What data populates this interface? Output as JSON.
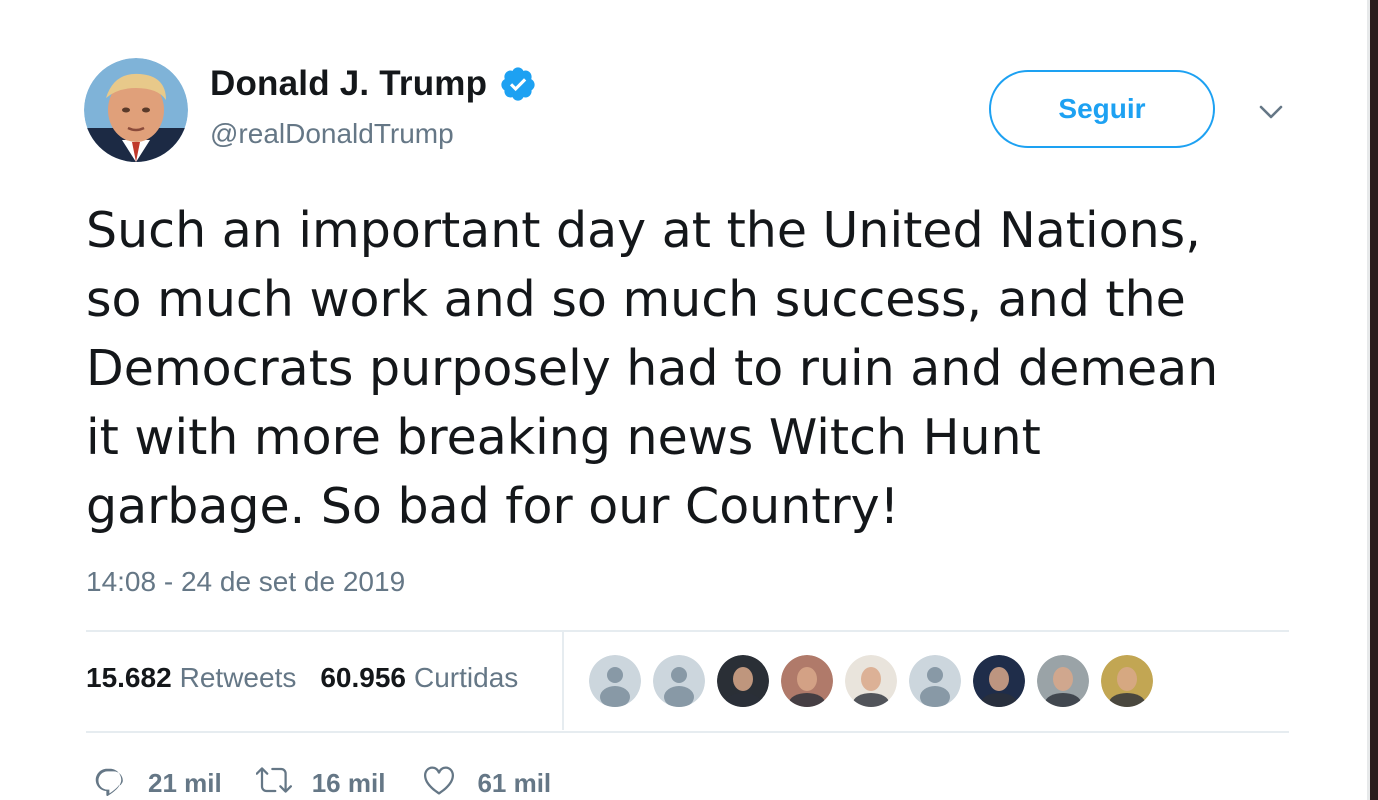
{
  "author": {
    "display_name": "Donald J. Trump",
    "handle": "@realDonaldTrump",
    "verified": true,
    "verified_color": "#1da1f2"
  },
  "follow_label": "Seguir",
  "tweet": {
    "lines": [
      "Such an important day at the United Nations,",
      "so much work and so much success, and the",
      "Democrats purposely had to ruin and demean",
      "it with more breaking news Witch Hunt",
      "garbage. So bad for our Country!"
    ],
    "timestamp": "14:08 - 24 de set de 2019"
  },
  "stats": {
    "retweets_count": "15.682",
    "retweets_label": "Retweets",
    "likes_count": "60.956",
    "likes_label": "Curtidas"
  },
  "likers": [
    {
      "avatar": "default-avatar",
      "bg": "#ccd6dd"
    },
    {
      "avatar": "default-avatar",
      "bg": "#ccd6dd"
    },
    {
      "avatar": "photo-avatar",
      "bg": "#2a2f36"
    },
    {
      "avatar": "photo-avatar",
      "bg": "#b07a6a"
    },
    {
      "avatar": "photo-avatar",
      "bg": "#e9e4dc"
    },
    {
      "avatar": "default-avatar",
      "bg": "#ccd6dd"
    },
    {
      "avatar": "photo-avatar",
      "bg": "#1f2d4a"
    },
    {
      "avatar": "photo-avatar",
      "bg": "#9aa3a7"
    },
    {
      "avatar": "photo-avatar",
      "bg": "#c2a653"
    }
  ],
  "actions": {
    "reply": {
      "icon": "reply-icon",
      "count": "21 mil"
    },
    "retweet": {
      "icon": "retweet-icon",
      "count": "16 mil"
    },
    "like": {
      "icon": "heart-icon",
      "count": "61 mil"
    }
  },
  "colors": {
    "accent": "#1da1f2",
    "text": "#14171a",
    "secondary": "#657786",
    "divider": "#e6ecf0"
  }
}
